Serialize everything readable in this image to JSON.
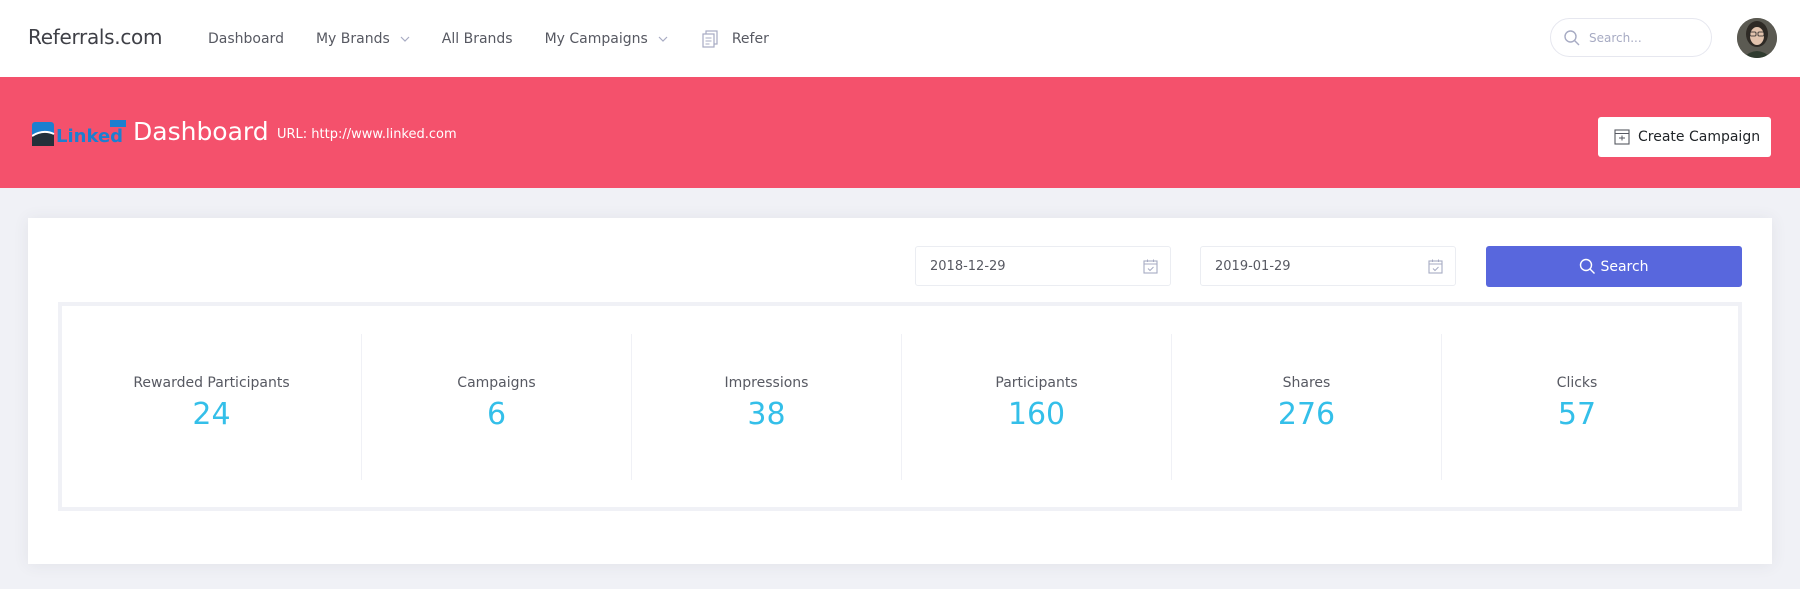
{
  "brand": "Referrals.com",
  "nav": {
    "dashboard": "Dashboard",
    "my_brands": "My Brands",
    "all_brands": "All Brands",
    "my_campaigns": "My Campaigns",
    "refer": "Refer"
  },
  "search": {
    "placeholder": "Search..."
  },
  "header": {
    "logo_text": "Linked",
    "title": "Dashboard",
    "url": "URL: http://www.linked.com",
    "create_campaign": "Create Campaign",
    "bg_color": "#f4516c"
  },
  "filters": {
    "start_date": "2018-12-29",
    "end_date": "2019-01-29",
    "search_label": "Search",
    "button_color": "#5867dd"
  },
  "stats": [
    {
      "label": "Rewarded Participants",
      "value": "24"
    },
    {
      "label": "Campaigns",
      "value": "6"
    },
    {
      "label": "Impressions",
      "value": "38"
    },
    {
      "label": "Participants",
      "value": "160"
    },
    {
      "label": "Shares",
      "value": "276"
    },
    {
      "label": "Clicks",
      "value": "57"
    }
  ],
  "icons": [
    "search-icon",
    "chevron-down-icon",
    "refer-icon",
    "avatar",
    "create-campaign-icon",
    "calendar-icon"
  ]
}
